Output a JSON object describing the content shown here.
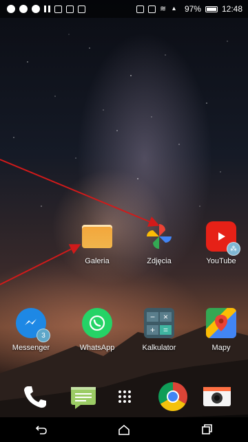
{
  "status_bar": {
    "battery": "97%",
    "time": "12:48"
  },
  "home": {
    "row1": [
      {
        "label": "Galeria",
        "icon": "galeria-icon"
      },
      {
        "label": "Zdjęcia",
        "icon": "photos-pinwheel-icon"
      },
      {
        "label": "YouTube",
        "icon": "youtube-icon"
      }
    ],
    "row2": [
      {
        "label": "Messenger",
        "icon": "messenger-icon",
        "badge": "3"
      },
      {
        "label": "WhatsApp",
        "icon": "whatsapp-icon"
      },
      {
        "label": "Kalkulator",
        "icon": "calculator-icon"
      },
      {
        "label": "Mapy",
        "icon": "maps-icon"
      }
    ]
  },
  "dock": [
    "phone-icon",
    "messages-icon",
    "app-drawer-icon",
    "chrome-icon",
    "camera-icon"
  ],
  "navigation": [
    "back-icon",
    "home-icon",
    "recents-icon"
  ],
  "colors": {
    "annotation_arrow": "#d11a1a",
    "youtube": "#e62117",
    "whatsapp": "#25d366"
  }
}
